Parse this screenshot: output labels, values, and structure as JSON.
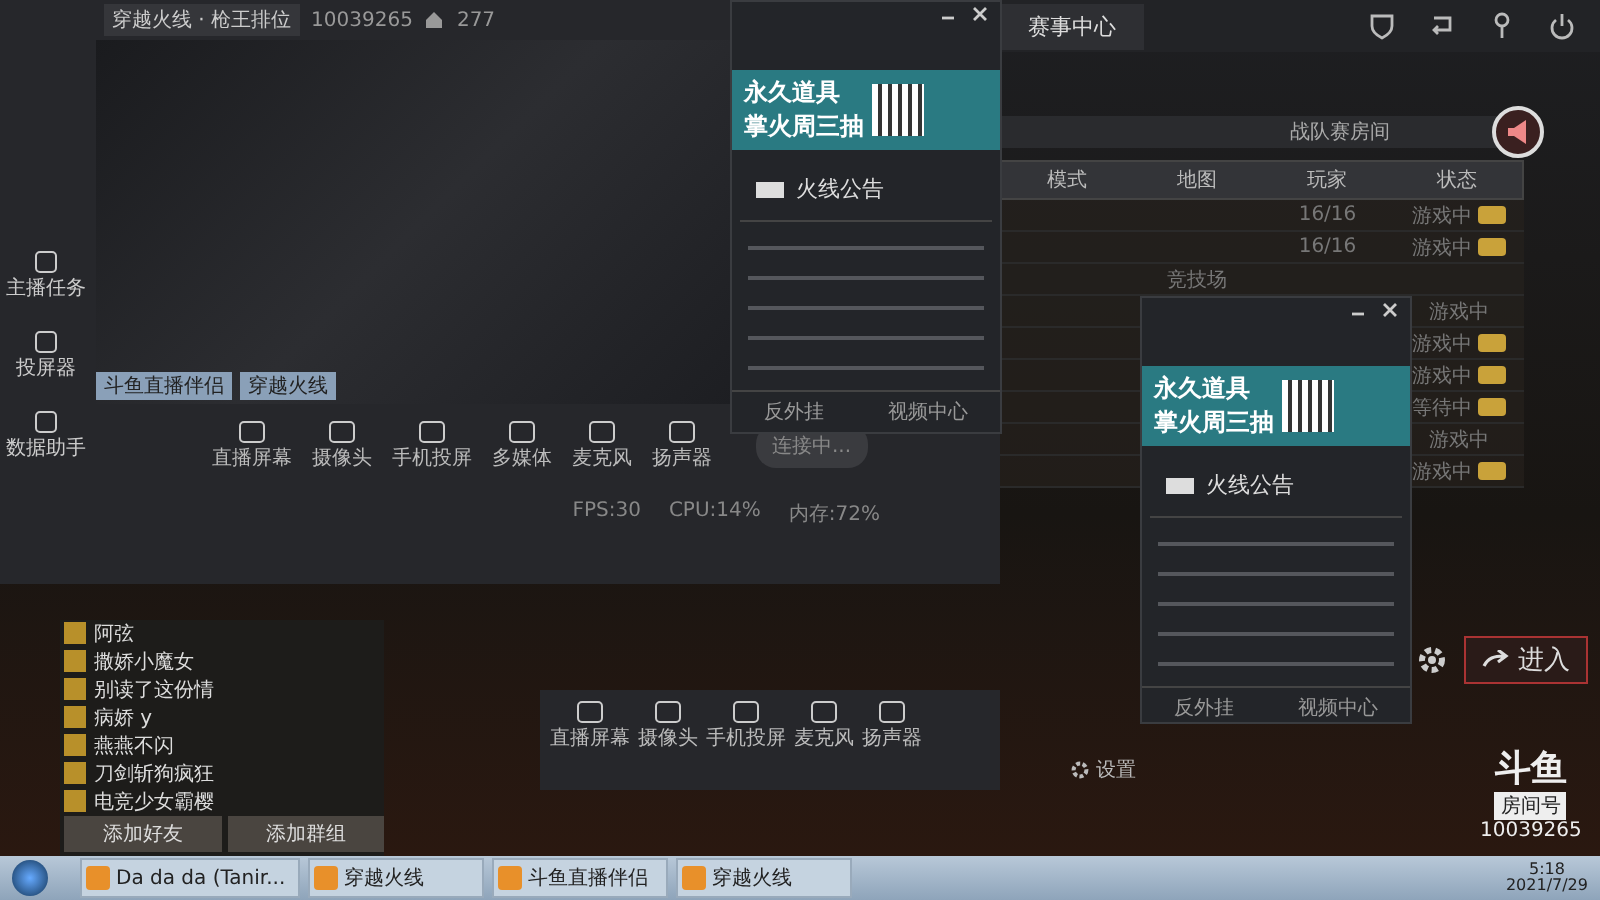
{
  "game_window": {
    "tabs": [
      {
        "label": "赛事中心",
        "selected": true
      }
    ],
    "room_title": "战队赛房间",
    "columns": [
      "模式",
      "地图",
      "玩家",
      "状态"
    ],
    "rows": [
      {
        "map": "",
        "players": "16/16",
        "status": "游戏中",
        "live": true
      },
      {
        "map": "",
        "players": "16/16",
        "status": "游戏中",
        "live": true
      },
      {
        "map": "竞技场",
        "players": "",
        "status": "",
        "live": false
      },
      {
        "map": "",
        "players": "",
        "status": "游戏中",
        "live": false
      },
      {
        "map": "",
        "players": "",
        "status": "游戏中",
        "live": true
      },
      {
        "map": "",
        "players": "",
        "status": "游戏中",
        "live": true
      },
      {
        "map": "",
        "players": "",
        "status": "等待中",
        "live": true
      },
      {
        "map": "",
        "players": "",
        "status": "游戏中",
        "live": false
      },
      {
        "map": "",
        "players": "",
        "status": "游戏中",
        "live": true
      }
    ],
    "enter_button": "进入",
    "logo": "斗鱼",
    "room_label": "房间号",
    "room_number": "10039265"
  },
  "stream_app": {
    "title": "穿越火线 · 枪王排位",
    "room_id": "10039265",
    "viewers": "277",
    "sidebar": [
      "主播任务",
      "投屏器",
      "数据助手"
    ],
    "toolbar": [
      "直播屏幕",
      "摄像头",
      "手机投屏",
      "多媒体",
      "麦克风",
      "扬声器"
    ],
    "connect_button": "连接中...",
    "stats": [
      "FPS:30",
      "CPU:14%",
      "内存:72%"
    ],
    "preview_tabs": [
      "斗鱼直播伴侣",
      "穿越火线"
    ]
  },
  "announcements": [
    {
      "banner": [
        "永久道具",
        "掌火周三抽"
      ],
      "heading": "火线公告",
      "footer": [
        "反外挂",
        "视频中心"
      ]
    },
    {
      "banner": [
        "永久道具",
        "掌火周三抽"
      ],
      "heading": "火线公告",
      "footer": [
        "反外挂",
        "视频中心"
      ]
    }
  ],
  "friends": {
    "names": [
      "阿弦",
      "撒娇小魔女",
      "别读了这份情",
      "病娇 y",
      "燕燕不闪",
      "刀剑斩狗疯狂",
      "电竞少女霸樱"
    ],
    "buttons": [
      "添加好友",
      "添加群组"
    ]
  },
  "lower_stream": {
    "toolbar": [
      "直播屏幕",
      "摄像头",
      "手机投屏",
      "麦克风",
      "扬声器"
    ],
    "settings": "设置"
  },
  "taskbar": {
    "items": [
      {
        "label": "Da da da (Tanir..."
      },
      {
        "label": "穿越火线"
      },
      {
        "label": "斗鱼直播伴侣"
      },
      {
        "label": "穿越火线"
      }
    ],
    "time": "5:18",
    "date": "2021/7/29"
  }
}
